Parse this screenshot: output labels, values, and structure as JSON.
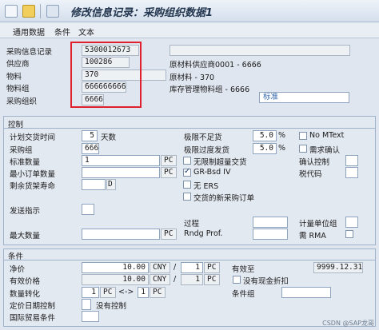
{
  "title": "修改信息记录：采购组织数据1",
  "menu": [
    "通用数据",
    "条件",
    "文本"
  ],
  "header": {
    "info_record_label": "采购信息记录",
    "info_record_value": "5300012673",
    "vendor_label": "供应商",
    "vendor_value": "100286",
    "vendor_desc": "原材料供应商0001 - 6666",
    "material_label": "物料",
    "material_value": "370",
    "material_desc": "原材料 - 370",
    "material_group_label": "物料组",
    "material_group_value": "666666666",
    "material_group_desc": "库存管理物料组 - 6666",
    "purch_org_label": "采购组织",
    "purch_org_value": "6666",
    "category_value": "标准"
  },
  "control": {
    "section_title": "控制",
    "plan_delivery_label": "计划交货时间",
    "plan_delivery_value": "5",
    "plan_delivery_unit": "天数",
    "purch_group_label": "采购组",
    "purch_group_value": "666",
    "std_qty_label": "标准数量",
    "std_qty_value": "1",
    "std_qty_unit": "PC",
    "min_qty_label": "最小订单数量",
    "min_qty_unit": "PC",
    "shelf_life_label": "剩余货架寿命",
    "shelf_life_unit": "D",
    "shipping_label": "发送指示",
    "max_qty_label": "最大数量",
    "max_qty_unit": "PC",
    "under_tol_label": "极限不足货",
    "under_tol_value": "5.0",
    "over_tol_label": "极限过度发货",
    "over_tol_value": "5.0",
    "percent": "%",
    "unlimited_label": "无限制超量交货",
    "gr_bsd_label": "GR-Bsd IV",
    "no_ers_label": "无 ERS",
    "new_po_label": "交货的新采购订单",
    "no_mtext_label": "No MText",
    "ack_req_label": "需求确认",
    "confirm_ctrl_label": "确认控制",
    "tax_code_label": "税代码",
    "procedure_label": "过程",
    "unit_group_label": "计量单位组",
    "rndg_label": "Rndg Prof.",
    "rma_label": "需 RMA",
    "gr_bsd_checked": true
  },
  "conditions": {
    "section_title": "条件",
    "net_price_label": "净价",
    "net_price_value": "10.00",
    "currency": "CNY",
    "per_value": "1",
    "per_unit": "PC",
    "effective_price_label": "有效价格",
    "effective_price_value": "10.00",
    "valid_to_label": "有效至",
    "valid_to_value": "9999.12.31",
    "no_cash_label": "没有现金折扣",
    "qty_conv_label": "数量转化",
    "conv_left": "1",
    "conv_left_unit": "PC",
    "conv_arrow": "<->",
    "conv_right": "1",
    "conv_right_unit": "PC",
    "cond_group_label": "条件组",
    "fixed_date_label": "定价日期控制",
    "fixed_date_value": "没有控制",
    "foreign_trade_label": "国际贸易条件",
    "slash": "/"
  },
  "watermark": "CSDN @SAP龙哥"
}
